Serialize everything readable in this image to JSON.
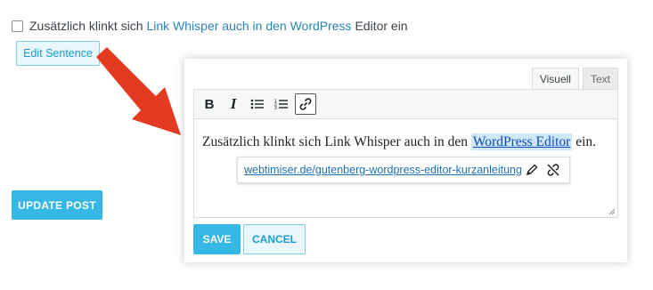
{
  "sentence": {
    "prefix": "Zusätzlich klinkt sich",
    "link_text": "Link Whisper auch in den WordPress",
    "suffix": "Editor ein"
  },
  "edit_sentence_label": "Edit Sentence",
  "update_post_label": "UPDATE POST",
  "editor": {
    "tabs": [
      {
        "label": "Visuell",
        "active": true
      },
      {
        "label": "Text",
        "active": false
      }
    ],
    "toolbar": [
      {
        "name": "bold",
        "glyph": "B"
      },
      {
        "name": "italic",
        "glyph": "I"
      },
      {
        "name": "bullet-list",
        "glyph": ""
      },
      {
        "name": "numbered-list",
        "glyph": ""
      },
      {
        "name": "link",
        "glyph": "",
        "active": true
      }
    ],
    "content_prefix": "Zusätzlich klinkt sich Link Whisper auch in den",
    "content_link": "WordPress Editor",
    "content_suffix": "ein.",
    "link_popup_url": "webtimiser.de/gutenberg-wordpress-editor-kurzanleitung",
    "save_label": "SAVE",
    "cancel_label": "CANCEL"
  },
  "colors": {
    "accent": "#35b8e5",
    "arrow": "#e23b22",
    "link": "#2271b1"
  }
}
